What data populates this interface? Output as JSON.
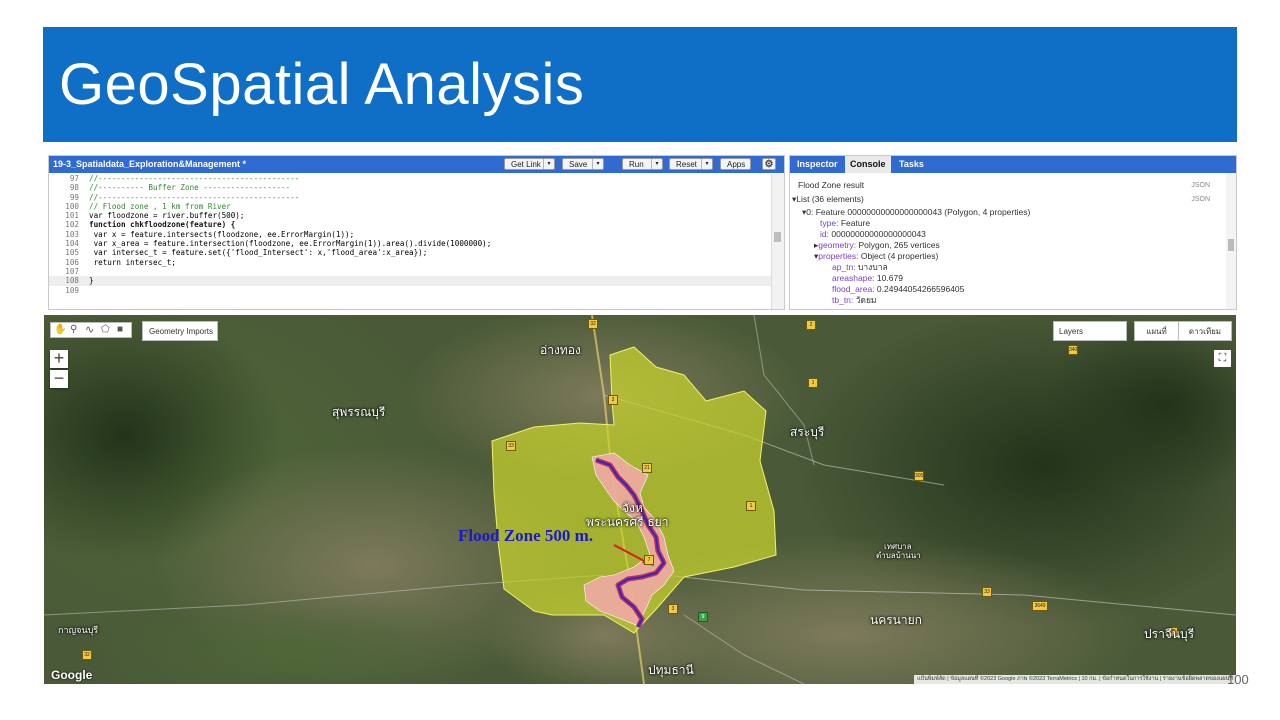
{
  "slide": {
    "title": "GeoSpatial Analysis",
    "page_number": "100"
  },
  "editor": {
    "title": "19-3_Spatialdata_Exploration&Management *",
    "buttons": {
      "get_link": "Get Link",
      "save": "Save",
      "run": "Run",
      "reset": "Reset",
      "apps": "Apps"
    },
    "lines": [
      {
        "n": "97",
        "text": "//--------------------------------------------"
      },
      {
        "n": "98",
        "text": "//---------- Buffer Zone -------------------"
      },
      {
        "n": "99",
        "text": "//--------------------------------------------"
      },
      {
        "n": "100",
        "text": "// Flood zone , 1 km from River"
      },
      {
        "n": "101",
        "text": "var floodzone = river.buffer(500);"
      },
      {
        "n": "102",
        "text": "function chkfloodzone(feature) {"
      },
      {
        "n": "103",
        "text": " var x = feature.intersects(floodzone, ee.ErrorMargin(1));"
      },
      {
        "n": "104",
        "text": " var x_area = feature.intersection(floodzone, ee.ErrorMargin(1)).area().divide(1000000);"
      },
      {
        "n": "105",
        "text": " var intersec_t = feature.set({'flood_Intersect': x,'flood_area':x_area});"
      },
      {
        "n": "106",
        "text": " return intersec_t;"
      },
      {
        "n": "107",
        "text": ""
      },
      {
        "n": "108",
        "text": "}"
      },
      {
        "n": "109",
        "text": ""
      }
    ]
  },
  "console": {
    "tabs": [
      "Inspector",
      "Console",
      "Tasks"
    ],
    "active_tab": "Console",
    "result_title": "Flood Zone result",
    "json_label": "JSON",
    "list_label": "List (36 elements)",
    "feature_label": "0: Feature 00000000000000000043 (Polygon, 4 properties)",
    "type_key": "type:",
    "type_val": "Feature",
    "id_key": "id:",
    "id_val": "00000000000000000043",
    "geometry_key": "geometry:",
    "geometry_val": "Polygon, 265 vertices",
    "properties_key": "properties:",
    "properties_val": "Object (4 properties)",
    "ap_tn_key": "ap_tn:",
    "ap_tn_val": "บางบาล",
    "areashape_key": "areashape:",
    "areashape_val": "10.679",
    "flood_area_key": "flood_area:",
    "flood_area_val": "0.24944054266596405",
    "tb_tn_key": "tb_tn:",
    "tb_tn_val": "วัดยม"
  },
  "map": {
    "geometry_imports": "Geometry Imports",
    "layers": "Layers",
    "map_btn": "แผนที่",
    "satellite_btn": "ดาวเทียม",
    "zoom_in": "+",
    "zoom_out": "−",
    "flood_label": "Flood Zone 500 m.",
    "google": "Google",
    "attribution": "แป้นพิมพ์ลัด | ข้อมูลแผนที่ ©2023 Google ภาพ ©2023 TerraMetrics | 10 กม. | ข้อกำหนดในการใช้งาน | รายงานข้อผิดพลาดของแผนที่",
    "places": {
      "angthong": "อ่างทอง",
      "suphan": "สุพรรณบุรี",
      "saraburi": "สระบุรี",
      "ayutthaya_1": "จังห",
      "ayutthaya_2": "พระนครศรี   ธยา",
      "nakhonnayok": "นครนายก",
      "prachin": "ปราจีนบุรี",
      "pathum": "ปทุมธานี",
      "kanchana": "กาญจนบุรี",
      "ban_na_1": "เทศบาล",
      "ban_na_2": "ตำบลบ้านนา"
    },
    "route_numbers": [
      "32",
      "3",
      "33",
      "21",
      "1",
      "9",
      "3",
      "7",
      "2",
      "33",
      "3649",
      "305",
      "340",
      "35",
      "32",
      "1"
    ]
  }
}
